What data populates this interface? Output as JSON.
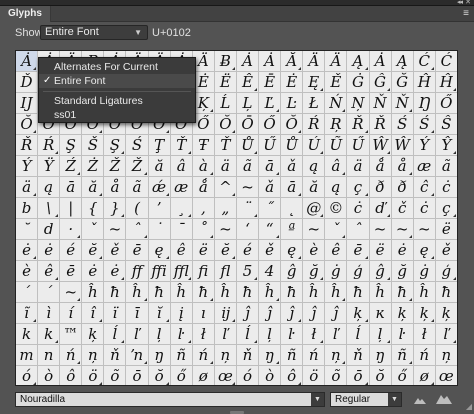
{
  "window": {
    "tab_title": "Glyphs",
    "collapse_icon": "double-chevron-icon",
    "close_icon": "close-icon",
    "menu_icon": "panel-menu-icon"
  },
  "toolbar": {
    "show_label": "Show:",
    "show_value": "Entire Font",
    "unicode": "U+0102"
  },
  "dropdown": {
    "items": [
      {
        "label": "Alternates For Current Selection",
        "checked": false
      },
      {
        "label": "Entire Font",
        "checked": true
      },
      {
        "label": "Standard Ligatures",
        "checked": false
      },
      {
        "label": "ss01",
        "checked": false
      }
    ],
    "check_icon": "✓"
  },
  "glyphs": [
    "Ȧ",
    "Ȧ",
    "Ä",
    "B",
    "Ȧ",
    "Ä",
    "Ä",
    "Ȧ",
    "Ä",
    "Ƀ",
    "Ȧ",
    "Ȧ",
    "Ă",
    "Ä",
    "Ä",
    "Ą",
    "Ȧ",
    "Ą",
    "Ć",
    "Ć",
    "Ď",
    "Ď",
    "Ċ",
    "Ď",
    "Đ",
    "Ď",
    "Ê",
    "Ę",
    "Ė",
    "Ë",
    "Ê",
    "Ē",
    "Ė",
    "Ę",
    "Ě",
    "Ġ",
    "Ĝ",
    "Ğ",
    "Ĥ",
    "Ĥ",
    "Ĳ",
    "Ĩ",
    "Ĭ",
    "Ĭ",
    "Į",
    "İ",
    "Ĳ",
    "Ĵ",
    "Ķ",
    "Ĺ",
    "Ļ",
    "Ľ",
    "Ŀ",
    "Ł",
    "Ń",
    "Ņ",
    "Ň",
    "Ň",
    "Ŋ",
    "Ő",
    "Ŏ",
    "Ŏ",
    "Ō",
    "Ő",
    "Ő",
    "Ŏ",
    "Ő",
    "Ö",
    "Ő",
    "Ŏ",
    "Ō",
    "Ő",
    "Ŏ",
    "Ŕ",
    "Ŗ",
    "Ř",
    "Ř",
    "Ś",
    "Ś",
    "Ŝ",
    "Ř",
    "Ŕ",
    "Ş",
    "Š",
    "Ş",
    "Ś",
    "Ţ",
    "Ť",
    "Ŧ",
    "Ť",
    "Ů",
    "Ű",
    "Ů",
    "Ú",
    "Ũ",
    "Ű",
    "Ŵ",
    "Ŵ",
    "Ý",
    "Ŷ",
    "Ý",
    "Ÿ",
    "Ź",
    "Ż",
    "Ž",
    "Ž",
    "ă",
    "â",
    "à",
    "ä",
    "ã",
    "ā",
    "ǎ",
    "ą",
    "â",
    "ä",
    "ǻ",
    "å",
    "æ",
    "ã",
    "ä",
    "ą",
    "ā",
    "ă",
    "å",
    "ã",
    "ǽ",
    "æ",
    "ǻ",
    "^",
    "~",
    "ǎ",
    "ā",
    "ă",
    "ą",
    "ç",
    "ð",
    "ð",
    "ĉ",
    "ċ",
    "b",
    "\\",
    "|",
    "{",
    "}",
    "(",
    "’",
    "¸",
    "‚",
    "„",
    "¨",
    "˝",
    "˛",
    "@",
    "©",
    "ċ",
    "ď",
    "č",
    "ċ",
    "ç",
    "˘",
    "d",
    "·",
    "ˇ",
    "~",
    "ˆ",
    "˙",
    "¯",
    "˚",
    "~",
    "‘",
    "“",
    "ª",
    "~",
    "ˇ",
    "ˆ",
    "~",
    "~",
    "~",
    "ë",
    "ė",
    "ė",
    "é",
    "ĕ",
    "ě",
    "ē",
    "ę",
    "ê",
    "ë",
    "ĕ",
    "é",
    "ě",
    "ę",
    "è",
    "ê",
    "ē",
    "ë",
    "ė",
    "ę",
    "ě",
    "è",
    "ê",
    "ē",
    "ė",
    "ė",
    "ff",
    "ffi",
    "ffl",
    "ﬁ",
    "ﬂ",
    "5",
    "4",
    "ĝ",
    "ğ",
    "ġ",
    "ģ",
    "ĝ",
    "ğ",
    "ġ",
    "ģ",
    "´",
    "´",
    "~",
    "ĥ",
    "ħ",
    "ĥ",
    "ħ",
    "ĥ",
    "ħ",
    "ĥ",
    "ħ",
    "ĥ",
    "ħ",
    "ĥ",
    "ĥ",
    "ħ",
    "ĥ",
    "ħ",
    "ĥ",
    "ħ",
    "ĩ",
    "ì",
    "í",
    "î",
    "ï",
    "ī",
    "ĭ",
    "į",
    "ı",
    "ĳ",
    "ĵ",
    "ĵ",
    "ĵ",
    "ĵ",
    "ĵ",
    "ķ",
    "ĸ",
    "ķ",
    "ķ",
    "ķ",
    "k",
    "k",
    "™",
    "ķ",
    "ĺ",
    "ľ",
    "ļ",
    "ŀ",
    "ł",
    "ľ",
    "ĺ",
    "ļ",
    "ŀ",
    "ł",
    "ľ",
    "ĺ",
    "ļ",
    "ŀ",
    "ł",
    "ľ",
    "m",
    "n",
    "ń",
    "ņ",
    "ň",
    "ŉ",
    "ŋ",
    "ñ",
    "ń",
    "ņ",
    "ň",
    "ŋ",
    "ñ",
    "ń",
    "ņ",
    "ň",
    "ŋ",
    "ñ",
    "ń",
    "ņ",
    "ó",
    "ò",
    "ô",
    "ö",
    "õ",
    "ō",
    "ŏ",
    "ő",
    "ø",
    "œ",
    "ó",
    "ò",
    "ô",
    "ö",
    "õ",
    "ō",
    "ŏ",
    "ő",
    "ø",
    "œ"
  ],
  "footer": {
    "font_family": "Nouradilla",
    "font_style": "Regular",
    "zoom_out_icon": "small-mountain-icon",
    "zoom_in_icon": "large-mountain-icon"
  }
}
